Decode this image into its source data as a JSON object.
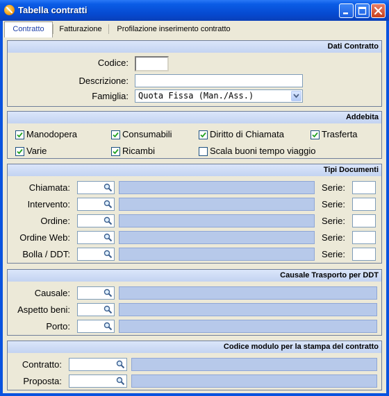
{
  "window": {
    "title": "Tabella contratti"
  },
  "tabs": [
    {
      "label": "Contratto",
      "active": true
    },
    {
      "label": "Fatturazione",
      "active": false
    },
    {
      "label": "Profilazione inserimento contratto",
      "active": false
    }
  ],
  "dati_contratto": {
    "title": "Dati Contratto",
    "codice_label": "Codice:",
    "codice_value": "",
    "descrizione_label": "Descrizione:",
    "descrizione_value": "",
    "famiglia_label": "Famiglia:",
    "famiglia_value": "Quota Fissa (Man./Ass.)"
  },
  "addebita": {
    "title": "Addebita",
    "items": [
      {
        "label": "Manodopera",
        "checked": true
      },
      {
        "label": "Consumabili",
        "checked": true
      },
      {
        "label": "Diritto di Chiamata",
        "checked": true
      },
      {
        "label": "Trasferta",
        "checked": true
      },
      {
        "label": "Varie",
        "checked": true
      },
      {
        "label": "Ricambi",
        "checked": true
      },
      {
        "label": "Scala buoni tempo viaggio",
        "checked": false
      }
    ]
  },
  "tipi_documenti": {
    "title": "Tipi Documenti",
    "serie_label": "Serie:",
    "rows": [
      {
        "label": "Chiamata:"
      },
      {
        "label": "Intervento:"
      },
      {
        "label": "Ordine:"
      },
      {
        "label": "Ordine Web:"
      },
      {
        "label": "Bolla / DDT:"
      }
    ]
  },
  "causale_trasporto": {
    "title": "Causale Trasporto per DDT",
    "rows": [
      {
        "label": "Causale:"
      },
      {
        "label": "Aspetto beni:"
      },
      {
        "label": "Porto:"
      }
    ]
  },
  "codice_modulo": {
    "title": "Codice modulo per la stampa del contratto",
    "rows": [
      {
        "label": "Contratto:"
      },
      {
        "label": "Proposta:"
      }
    ]
  },
  "colors": {
    "titlebar": "#0a53df",
    "panel_header": "#c3d3f1",
    "readonly_field": "#b7c9ea",
    "dialog_bg": "#ece9d8"
  },
  "icons": [
    "app-icon",
    "minimize-icon",
    "maximize-icon",
    "close-icon",
    "magnifier-icon",
    "chevron-down-icon",
    "checkmark-icon"
  ]
}
